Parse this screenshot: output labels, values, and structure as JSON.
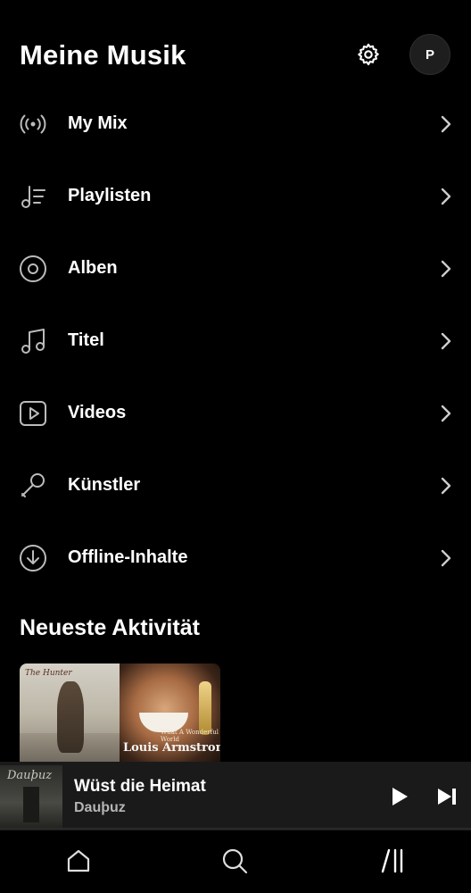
{
  "header": {
    "title": "Meine Musik",
    "avatar_initial": "P",
    "settings_icon": "gear-icon"
  },
  "menu": {
    "items": [
      {
        "label": "My Mix",
        "icon": "radio-broadcast-icon"
      },
      {
        "label": "Playlisten",
        "icon": "playlist-icon"
      },
      {
        "label": "Alben",
        "icon": "album-disc-icon"
      },
      {
        "label": "Titel",
        "icon": "music-note-icon"
      },
      {
        "label": "Videos",
        "icon": "video-play-icon"
      },
      {
        "label": "Künstler",
        "icon": "microphone-icon"
      },
      {
        "label": "Offline-Inhalte",
        "icon": "download-circle-icon"
      }
    ]
  },
  "recent": {
    "title": "Neueste Aktivität",
    "card": {
      "left_art_text": "The Hunter",
      "right_art_small": "What A Wonderful World",
      "right_art_name": "Louis Armstrong"
    }
  },
  "player": {
    "track_title": "Wüst die Heimat",
    "artist": "Dauþuz",
    "cover_text": "Dauþuz"
  },
  "nav": {
    "items": [
      "home-icon",
      "search-icon",
      "library-icon"
    ]
  },
  "colors": {
    "background": "#000000",
    "text": "#ffffff",
    "secondary_text": "#b5b5b5",
    "player_bg": "#1a1a1a"
  }
}
